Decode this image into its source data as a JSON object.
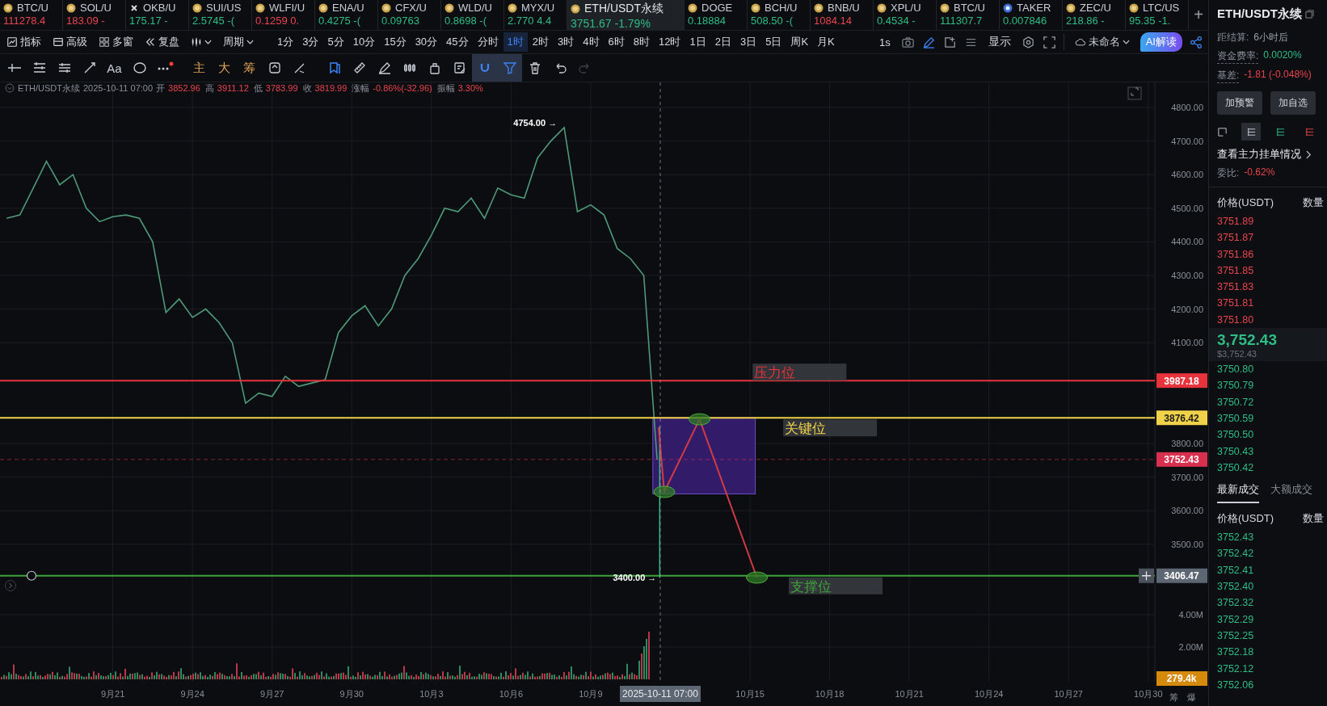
{
  "tickers": [
    {
      "symbol": "BTC/U",
      "quote": "111278.4",
      "color": "#e8454f",
      "kind": "coin",
      "selected": false
    },
    {
      "symbol": "SOL/U",
      "quote": "183.09 -",
      "color": "#e8454f",
      "kind": "coin",
      "selected": false
    },
    {
      "symbol": "OKB/U",
      "quote": "175.17 -",
      "color": "#2ebd85",
      "kind": "cross",
      "selected": false
    },
    {
      "symbol": "SUI/US",
      "quote": "2.5745 -(",
      "color": "#2ebd85",
      "kind": "coin",
      "selected": false
    },
    {
      "symbol": "WLFI/U",
      "quote": "0.1259 0.",
      "color": "#e8454f",
      "kind": "coin",
      "selected": false
    },
    {
      "symbol": "ENA/U",
      "quote": "0.4275 -(",
      "color": "#2ebd85",
      "kind": "coin",
      "selected": false
    },
    {
      "symbol": "CFX/U",
      "quote": "0.09763",
      "color": "#2ebd85",
      "kind": "coin",
      "selected": false
    },
    {
      "symbol": "WLD/U",
      "quote": "0.8698 -(",
      "color": "#2ebd85",
      "kind": "coin",
      "selected": false
    },
    {
      "symbol": "MYX/U",
      "quote": "2.770 4.4",
      "color": "#2ebd85",
      "kind": "coin",
      "selected": false
    },
    {
      "symbol": "ETH/USDT永续",
      "quote": "3751.67 -1.79%",
      "color": "#2ebd85",
      "kind": "coin",
      "selected": true
    },
    {
      "symbol": "DOGE",
      "quote": "0.18884",
      "color": "#2ebd85",
      "kind": "coin",
      "selected": false
    },
    {
      "symbol": "BCH/U",
      "quote": "508.50 -(",
      "color": "#2ebd85",
      "kind": "coin",
      "selected": false
    },
    {
      "symbol": "BNB/U",
      "quote": "1084.14",
      "color": "#e8454f",
      "kind": "coin",
      "selected": false
    },
    {
      "symbol": "XPL/U",
      "quote": "0.4534 -",
      "color": "#2ebd85",
      "kind": "coin",
      "selected": false
    },
    {
      "symbol": "BTC/U",
      "quote": "111307.7",
      "color": "#2ebd85",
      "kind": "coin",
      "selected": false
    },
    {
      "symbol": "TAKER",
      "quote": "0.007846",
      "color": "#2ebd85",
      "kind": "badge",
      "selected": false
    },
    {
      "symbol": "ZEC/U",
      "quote": "218.86 -",
      "color": "#2ebd85",
      "kind": "coin",
      "selected": false
    },
    {
      "symbol": "LTC/US",
      "quote": "95.35 -1.",
      "color": "#2ebd85",
      "kind": "coin",
      "selected": false
    }
  ],
  "add_tab": "+",
  "toolbar_buttons": [
    {
      "label": "指标"
    },
    {
      "label": "高级"
    },
    {
      "label": "多窗"
    },
    {
      "label": "复盘"
    }
  ],
  "period_menu": "周期",
  "intervals": [
    {
      "label": "1分",
      "selected": false
    },
    {
      "label": "3分",
      "selected": false
    },
    {
      "label": "5分",
      "selected": false
    },
    {
      "label": "10分",
      "selected": false
    },
    {
      "label": "15分",
      "selected": false
    },
    {
      "label": "30分",
      "selected": false
    },
    {
      "label": "45分",
      "selected": false
    },
    {
      "label": "分时",
      "selected": false
    },
    {
      "label": "1时",
      "selected": true
    },
    {
      "label": "2时",
      "selected": false
    },
    {
      "label": "3时",
      "selected": false
    },
    {
      "label": "4时",
      "selected": false
    },
    {
      "label": "6时",
      "selected": false
    },
    {
      "label": "8时",
      "selected": false
    },
    {
      "label": "12时",
      "selected": false
    },
    {
      "label": "1日",
      "selected": false
    },
    {
      "label": "2日",
      "selected": false
    },
    {
      "label": "3日",
      "selected": false
    },
    {
      "label": "5日",
      "selected": false
    },
    {
      "label": "周K",
      "selected": false
    },
    {
      "label": "月K",
      "selected": false
    }
  ],
  "toolbar_right": {
    "second_interval": "1s",
    "display": "显示",
    "layout_name": "未命名",
    "ai_button": "AI解读"
  },
  "drawing_tools": [
    {
      "kind": "icon",
      "active": false
    },
    {
      "kind": "icon",
      "active": false
    },
    {
      "kind": "icon",
      "active": false
    },
    {
      "kind": "icon",
      "active": false
    },
    {
      "kind": "text",
      "label": "Aa",
      "active": false
    },
    {
      "kind": "icon",
      "active": false
    },
    {
      "kind": "more",
      "active": false,
      "dot": true
    },
    {
      "kind": "text",
      "label": "主",
      "active": false,
      "accent": true
    },
    {
      "kind": "text",
      "label": "大",
      "active": false,
      "accent": true
    },
    {
      "kind": "text",
      "label": "筹",
      "active": false,
      "accent": true
    },
    {
      "kind": "icon",
      "active": false
    },
    {
      "kind": "icon",
      "active": false
    },
    {
      "kind": "icon",
      "active": false
    },
    {
      "kind": "icon",
      "active": false
    },
    {
      "kind": "icon",
      "active": false
    },
    {
      "kind": "icon",
      "active": false
    },
    {
      "kind": "icon",
      "active": false
    },
    {
      "kind": "icon",
      "active": false
    },
    {
      "kind": "icon",
      "active": true
    },
    {
      "kind": "icon",
      "active": true
    },
    {
      "kind": "icon",
      "active": false
    },
    {
      "kind": "icon",
      "active": false
    },
    {
      "kind": "icon",
      "active": false,
      "disabled": true
    }
  ],
  "info_bar": {
    "symbol": "ETH/USDT永续",
    "time": "2025-10-11 07:00",
    "fields": [
      {
        "label": "开",
        "value": "3852.96"
      },
      {
        "label": "高",
        "value": "3911.12"
      },
      {
        "label": "低",
        "value": "3783.99"
      },
      {
        "label": "收",
        "value": "3819.99"
      },
      {
        "label": "涨幅",
        "value": "-0.86%(-32.96)"
      },
      {
        "label": "振幅",
        "value": "3.30%"
      }
    ]
  },
  "chart": {
    "chart_data": {
      "type": "line",
      "ylim": [
        3091,
        4874.5
      ],
      "grid": true,
      "ref_lines": [
        {
          "axis": "y",
          "value": 3987.18,
          "label": "3987.18",
          "color": "#e8323c"
        },
        {
          "axis": "y",
          "value": 3876.42,
          "label": "3876.42",
          "color": "#f0d24a"
        },
        {
          "axis": "y",
          "value": 3752.43,
          "label": "3752.43",
          "color": "#d9304f"
        },
        {
          "axis": "y",
          "value": 3406.47,
          "label": "3406.47",
          "color": "#3fa33a"
        }
      ],
      "categories": [
        null,
        null,
        null,
        null,
        null,
        null,
        null,
        null,
        "9月21",
        null,
        null,
        null,
        null,
        null,
        "9月24",
        null,
        null,
        null,
        null,
        null,
        "9月27",
        null,
        null,
        null,
        null,
        null,
        "9月30",
        null,
        null,
        null,
        null,
        null,
        "10月3",
        null,
        null,
        null,
        null,
        null,
        "10月6",
        null,
        null,
        null,
        null,
        null,
        "10月9",
        null,
        null,
        null,
        null,
        null,
        null,
        null,
        null,
        null,
        null,
        null,
        "10月15",
        null,
        null,
        null,
        null,
        null,
        "10月18",
        null,
        null,
        null,
        null,
        null,
        "10月21",
        null,
        null,
        null,
        null,
        null,
        "10月24",
        null,
        null,
        null,
        null,
        null,
        "10月27",
        null,
        null,
        null,
        null,
        null,
        "10月30"
      ],
      "yticks": [
        {
          "value": 4800,
          "label": "4800.00"
        },
        {
          "value": 4700,
          "label": "4700.00"
        },
        {
          "value": 4600,
          "label": "4600.00"
        },
        {
          "value": 4500,
          "label": "4500.00"
        },
        {
          "value": 4400,
          "label": "4400.00"
        },
        {
          "value": 4300,
          "label": "4300.00"
        },
        {
          "value": 4200,
          "label": "4200.00"
        },
        {
          "value": 4100,
          "label": "4100.00"
        },
        {
          "value": 3800,
          "label": "3800.00"
        },
        {
          "value": 3700,
          "label": "3700.00"
        },
        {
          "value": 3600,
          "label": "3600.00"
        },
        {
          "value": 3500,
          "label": "3500.00"
        }
      ],
      "series": [
        {
          "color": "#4f9a78",
          "values": [
            4470,
            4480,
            4560,
            4640,
            4570,
            4600,
            4500,
            4460,
            4475,
            4480,
            4470,
            4400,
            4190,
            4230,
            4175,
            4200,
            4160,
            4100,
            3920,
            3950,
            3940,
            4000,
            3970,
            3980,
            3990,
            4130,
            4180,
            4210,
            4150,
            4200,
            4300,
            4350,
            4420,
            4500,
            4490,
            4530,
            4470,
            4560,
            4540,
            4530,
            4650,
            4700,
            4740,
            4490,
            4510,
            4480,
            4380,
            4350,
            4300,
            3752,
            null,
            null,
            null,
            null,
            null,
            null,
            null,
            null,
            null,
            null,
            null,
            null,
            null,
            null,
            null,
            null,
            null,
            null,
            null,
            null,
            null,
            null,
            null,
            null,
            null,
            null,
            null,
            null,
            null,
            null,
            null,
            null,
            null,
            null,
            null,
            null,
            null
          ]
        }
      ]
    },
    "level_labels": [
      "压力位",
      "关键位",
      "支撑位"
    ],
    "extremes": [
      "4754.00 →",
      "3400.00 →"
    ],
    "crosshair_time": "2025-10-11 07:00",
    "volume_ticks": [
      "4.00M",
      "2.00M"
    ],
    "volume_badge": "279.4k",
    "axis_buttons": [
      "筹",
      "爆"
    ]
  },
  "side_panel": {
    "title": "ETH/USDT永续",
    "stats": [
      {
        "label": "距结算:",
        "value": "6小时后",
        "color": "#9aa0a8"
      },
      {
        "label": "资金费率:",
        "value": "0.0020%",
        "color": "#2ebd85"
      },
      {
        "label": "基差:",
        "value": "-1.81 (-0.048%)",
        "color": "#e8454f"
      }
    ],
    "buttons": [
      "加预警",
      "加自选"
    ],
    "view_tabs": [
      {
        "selected": false
      },
      {
        "selected": true
      },
      {
        "selected": false
      },
      {
        "selected": false
      }
    ],
    "depth_link": "查看主力挂单情况",
    "ratio": {
      "label": "委比:",
      "value": "-0.62%"
    },
    "book_header": {
      "price": "价格(USDT)",
      "qty": "数量"
    },
    "asks": [
      "3751.89",
      "3751.87",
      "3751.86",
      "3751.85",
      "3751.83",
      "3751.81",
      "3751.80"
    ],
    "last_price": "3,752.43",
    "last_price_usd": "$3,752.43",
    "bids": [
      "3750.80",
      "3750.79",
      "3750.72",
      "3750.59",
      "3750.50",
      "3750.43",
      "3750.42"
    ],
    "trade_tabs": [
      {
        "label": "最新成交",
        "selected": true
      },
      {
        "label": "大额成交",
        "selected": false
      }
    ],
    "trade_header": {
      "price": "价格(USDT)",
      "qty": "数量"
    },
    "trades": [
      "3752.43",
      "3752.42",
      "3752.41",
      "3752.40",
      "3752.32",
      "3752.29",
      "3752.25",
      "3752.18",
      "3752.12",
      "3752.06"
    ]
  }
}
